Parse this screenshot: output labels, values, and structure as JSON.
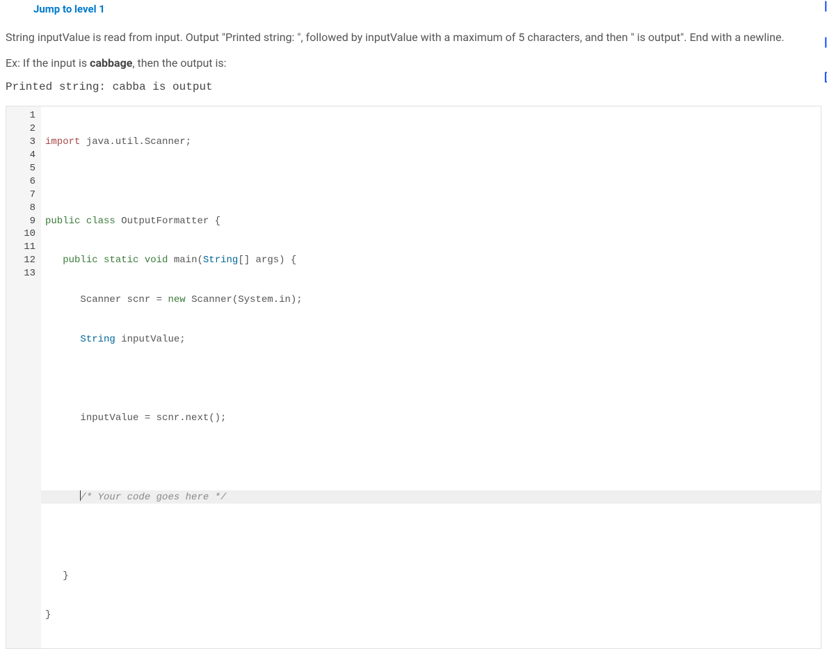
{
  "header": {
    "jump_link": "Jump to level 1"
  },
  "prompt": {
    "line1_a": "String inputValue is read from input. Output \"Printed string: \", followed by inputValue with a maximum of 5 characters, and then",
    "line2": "\" is output\". End with a newline.",
    "example_prefix": "Ex: If the input is ",
    "example_input": "cabbage",
    "example_suffix": ", then the output is:",
    "example_output": "Printed string: cabba is output"
  },
  "code": {
    "line_numbers": [
      "1",
      "2",
      "3",
      "4",
      "5",
      "6",
      "7",
      "8",
      "9",
      "10",
      "11",
      "12",
      "13"
    ],
    "l1_import": "import",
    "l1_rest": " java.util.Scanner;",
    "l3_public": "public",
    "l3_class": " class",
    "l3_rest": " OutputFormatter {",
    "l4_pad": "   ",
    "l4_public": "public",
    "l4_static": " static",
    "l4_void": " void",
    "l4_main": " main(",
    "l4_string": "String",
    "l4_rest": "[] args) {",
    "l5_pad": "      ",
    "l5_a": "Scanner scnr = ",
    "l5_new": "new",
    "l5_b": " Scanner(System.in);",
    "l6_pad": "      ",
    "l6_string": "String",
    "l6_rest": " inputValue;",
    "l8_pad": "      ",
    "l8": "inputValue = scnr.next();",
    "l10_pad": "      ",
    "l10_comment": "/* Your code goes here */",
    "l12_pad": "   ",
    "l12": "}",
    "l13": "}"
  },
  "side": {
    "mark1": "|",
    "mark2": "|",
    "mark3": "["
  }
}
